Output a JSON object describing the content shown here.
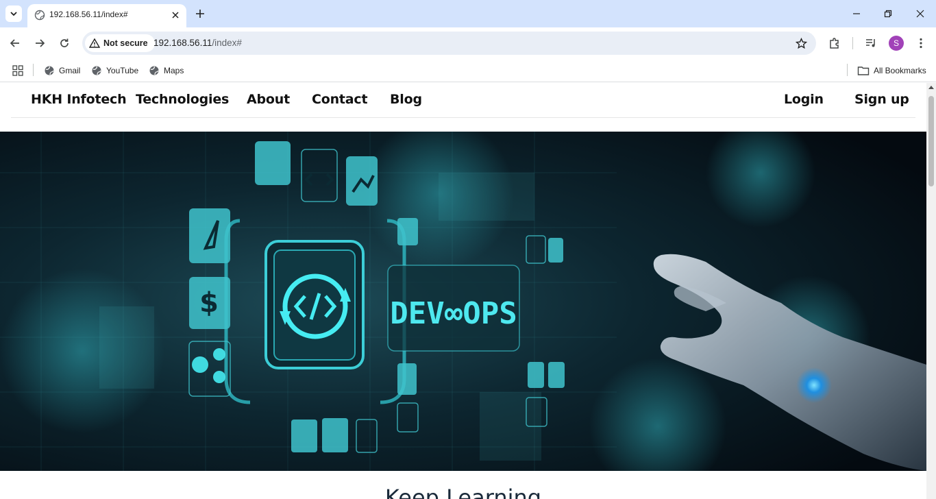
{
  "browser": {
    "tab": {
      "title": "192.168.56.11/index#"
    },
    "address": {
      "security_label": "Not secure",
      "url_host": "192.168.56.11",
      "url_path": "/index#"
    },
    "profile_initial": "S",
    "bookmarks": [
      {
        "label": "Gmail",
        "icon": "globe-icon"
      },
      {
        "label": "YouTube",
        "icon": "globe-icon"
      },
      {
        "label": "Maps",
        "icon": "globe-icon"
      }
    ],
    "all_bookmarks_label": "All Bookmarks"
  },
  "site": {
    "brand": "HKH Infotech",
    "nav": [
      "Technologies",
      "About",
      "Contact",
      "Blog"
    ],
    "auth": {
      "login": "Login",
      "signup": "Sign up"
    }
  },
  "hero": {
    "overlay_text": "DEV∞OPS",
    "accent": "#35e0e8"
  },
  "section": {
    "title": "Keep Learning"
  }
}
